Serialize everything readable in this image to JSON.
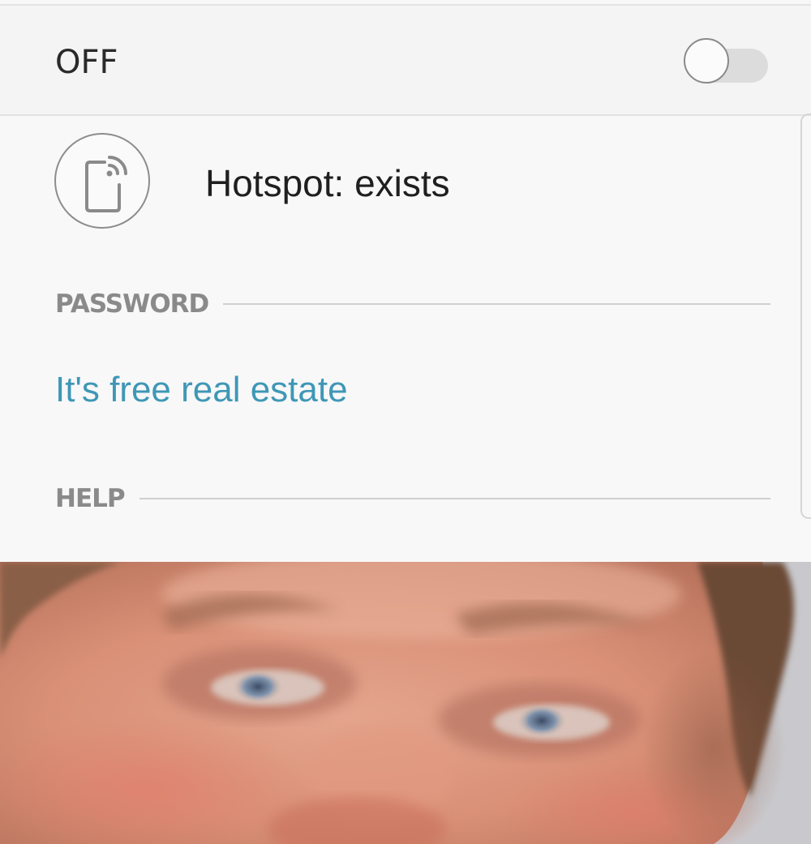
{
  "master_switch": {
    "label": "OFF",
    "state": "off",
    "track_color": "#dcdcdc",
    "thumb_color": "#fbfbfb"
  },
  "hotspot": {
    "icon": "mobile-hotspot-icon",
    "label": "Hotspot: exists"
  },
  "password_section": {
    "title": "PASSWORD",
    "value": "It's free real estate",
    "value_color": "#3f97b6"
  },
  "help_section": {
    "title": "HELP"
  },
  "image": {
    "description_icon": "face-photo"
  }
}
